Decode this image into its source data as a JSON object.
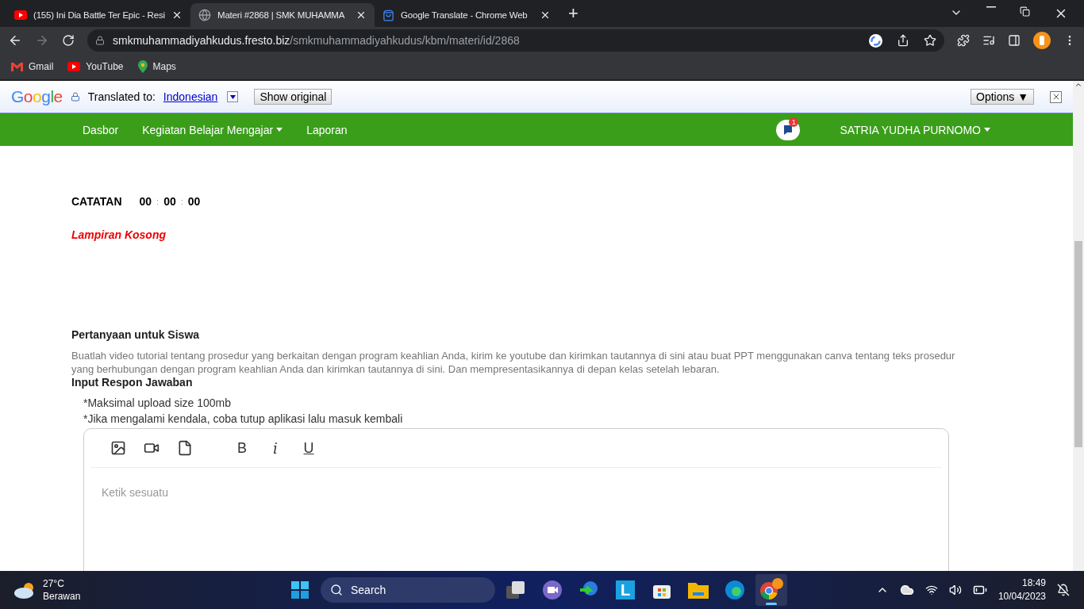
{
  "browser": {
    "tabs": [
      {
        "title": "(155) Ini Dia Battle Ter Epic - Resi",
        "kind": "youtube",
        "selected": false
      },
      {
        "title": "Materi #2868 | SMK MUHAMMA",
        "kind": "globe",
        "selected": true
      },
      {
        "title": "Google Translate - Chrome Web",
        "kind": "store",
        "selected": false
      }
    ],
    "new_tab": "+",
    "url": {
      "host": "smkmuhammadiyahkudus.fresto.biz",
      "path": "/smkmuhammadiyahkudus/kbm/materi/id/2868"
    },
    "bookmarks": [
      {
        "label": "Gmail",
        "kind": "gmail"
      },
      {
        "label": "YouTube",
        "kind": "youtube"
      },
      {
        "label": "Maps",
        "kind": "maps"
      }
    ]
  },
  "translate_bar": {
    "brand": "Google",
    "label": "Translated to:",
    "language": "Indonesian",
    "show_original": "Show original",
    "options": "Options ▼"
  },
  "nav": {
    "items": [
      {
        "label": "Dasbor",
        "dropdown": false
      },
      {
        "label": "Kegiatan Belajar Mengajar",
        "dropdown": true
      },
      {
        "label": "Laporan",
        "dropdown": false
      }
    ],
    "notification_count": "1",
    "user": "SATRIA YUDHA PURNOMO"
  },
  "content": {
    "timer_label": "CATATAN",
    "timer": [
      {
        "text": "00",
        "kind": "digit"
      },
      {
        "text": ":",
        "kind": "sep"
      },
      {
        "text": "00",
        "kind": "digit"
      },
      {
        "text": ":",
        "kind": "sep"
      },
      {
        "text": "00",
        "kind": "digit"
      }
    ],
    "attachment_note": "Lampiran Kosong",
    "question_title": "Pertanyaan untuk Siswa",
    "question_text": "Buatlah video tutorial tentang prosedur yang berkaitan dengan program keahlian Anda, kirim ke youtube dan kirimkan tautannya di sini atau buat PPT menggunakan canva tentang teks prosedur yang berhubungan dengan program keahlian Anda dan kirimkan tautannya di sini. Dan mempresentasikannya di depan kelas setelah lebaran.",
    "response_title": "Input Respon Jawaban",
    "notes": [
      "*Maksimal upload size 100mb",
      "*Jika mengalami kendala, coba tutup aplikasi lalu masuk kembali"
    ],
    "editor": {
      "tools": [
        {
          "kind": "image"
        },
        {
          "kind": "video"
        },
        {
          "kind": "file"
        },
        {
          "kind": "bold",
          "label": "B"
        },
        {
          "kind": "italic",
          "label": "i"
        },
        {
          "kind": "underline",
          "label": "U"
        }
      ],
      "placeholder": "Ketik sesuatu"
    }
  },
  "taskbar": {
    "weather": {
      "temp": "27°C",
      "condition": "Berawan"
    },
    "search": "Search",
    "apps": [
      {
        "kind": "taskview",
        "selected": false
      },
      {
        "kind": "meet",
        "selected": false
      },
      {
        "kind": "download",
        "selected": false
      },
      {
        "kind": "letter",
        "label": "L",
        "selected": false
      },
      {
        "kind": "store",
        "selected": false
      },
      {
        "kind": "folder",
        "selected": false
      },
      {
        "kind": "edge",
        "selected": false
      },
      {
        "kind": "chrome",
        "selected": true
      }
    ],
    "time": "18:49",
    "date": "10/04/2023"
  }
}
